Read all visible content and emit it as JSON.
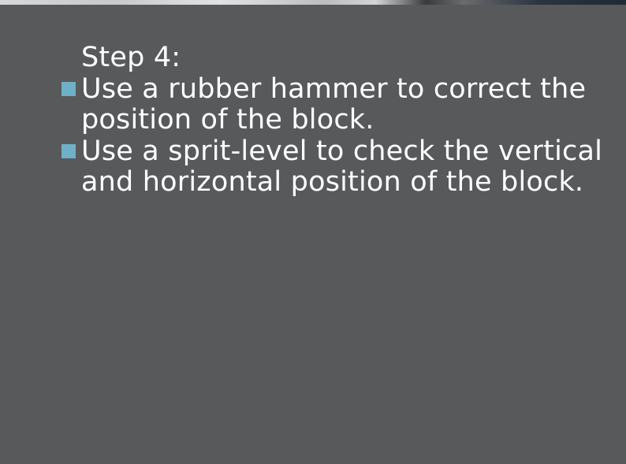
{
  "slide": {
    "heading": "Step 4:",
    "bullets": [
      {
        "text": "Use a rubber hammer to correct the position of the block."
      },
      {
        "text": "Use a sprit-level to check the vertical and horizontal position of the block."
      }
    ]
  },
  "colors": {
    "background": "#58595b",
    "text": "#ffffff",
    "bullet_marker": "#6fb0c8"
  },
  "icons": {
    "bullet_marker": "square-bullet-icon"
  }
}
